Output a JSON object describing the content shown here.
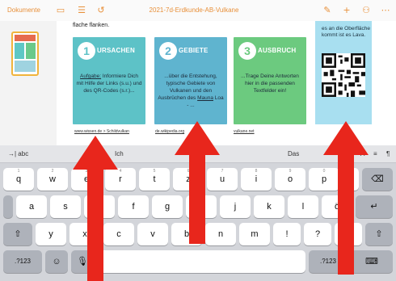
{
  "toolbar": {
    "docs_label": "Dokumente",
    "title": "2021-7d-Erdkunde-AB-Vulkane"
  },
  "document": {
    "intro_text": "flache flanken.",
    "cards": [
      {
        "num": "1",
        "title": "URSACHEN",
        "body_link": "Aufgabe:",
        "body": " Informiere Dich mit Hilfe der Links (s.u.) und des QR-Codes (s.r.)..."
      },
      {
        "num": "2",
        "title": "GEBIETE",
        "body": "...über die Entstehung, typische Gebiete von Vulkanen und den Ausbrüchen des ",
        "body_link": "Mauna",
        "body_end": " Loa - ..."
      },
      {
        "num": "3",
        "title": "AUSBRUCH",
        "body": "...Trage Deine Antworten hier in die passenden Textfelder ein!"
      }
    ],
    "side_text": "es an die Oberfläche kommt ist es Lava.",
    "links": [
      "www.wissen.de > Schildvulkan",
      "de.wikipedia.org",
      "vulkane.net"
    ]
  },
  "keyboard": {
    "suggestions": [
      "→| abc",
      "Ich",
      "Das"
    ],
    "row1": [
      "q",
      "w",
      "e",
      "r",
      "t",
      "z",
      "u",
      "i",
      "o",
      "p",
      "ü"
    ],
    "row1_sub": [
      "1",
      "2",
      "3",
      "4",
      "5",
      "6",
      "7",
      "8",
      "9",
      "0",
      ""
    ],
    "row2": [
      "a",
      "s",
      "d",
      "f",
      "g",
      "h",
      "j",
      "k",
      "l",
      "ö"
    ],
    "row3": [
      "y",
      "x",
      "c",
      "v",
      "b",
      "n",
      "m",
      "!",
      "?",
      "ß"
    ],
    "row3_sub": [
      "",
      "",
      "",
      "",
      "",
      "",
      "",
      "!",
      "?",
      ""
    ],
    "numbers_label": ".?123",
    "backspace_icon": "backspace-icon",
    "return_icon": "return-icon",
    "shift_icon": "shift-icon"
  },
  "colors": {
    "accent": "#e8903a",
    "card1": "#5dc2c7",
    "card2": "#5fb4cf",
    "card3": "#6cca7f",
    "arrow": "#e8261c"
  }
}
